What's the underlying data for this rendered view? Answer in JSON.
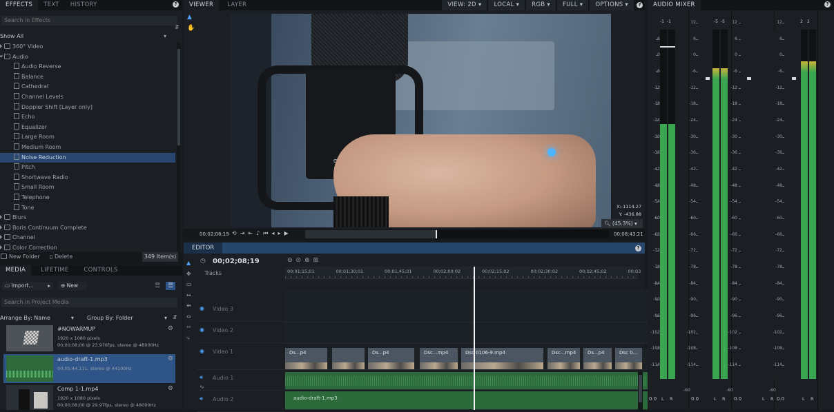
{
  "effects_panel": {
    "tabs": [
      "EFFECTS",
      "TEXT",
      "HISTORY"
    ],
    "search_placeholder": "Search in Effects",
    "filter": "Show All",
    "tree": [
      {
        "label": "360° Video",
        "kind": "folder",
        "level": 0
      },
      {
        "label": "Audio",
        "kind": "folder-open",
        "level": 0
      },
      {
        "label": "Audio Reverse",
        "kind": "effect",
        "level": 1
      },
      {
        "label": "Balance",
        "kind": "effect",
        "level": 1
      },
      {
        "label": "Cathedral",
        "kind": "effect",
        "level": 1
      },
      {
        "label": "Channel Levels",
        "kind": "effect",
        "level": 1
      },
      {
        "label": "Doppler Shift [Layer only]",
        "kind": "effect",
        "level": 1
      },
      {
        "label": "Echo",
        "kind": "effect",
        "level": 1
      },
      {
        "label": "Equalizer",
        "kind": "effect",
        "level": 1
      },
      {
        "label": "Large Room",
        "kind": "effect",
        "level": 1
      },
      {
        "label": "Medium Room",
        "kind": "effect",
        "level": 1
      },
      {
        "label": "Noise Reduction",
        "kind": "effect",
        "level": 1,
        "selected": true
      },
      {
        "label": "Pitch",
        "kind": "effect",
        "level": 1
      },
      {
        "label": "Shortwave Radio",
        "kind": "effect",
        "level": 1
      },
      {
        "label": "Small Room",
        "kind": "effect",
        "level": 1
      },
      {
        "label": "Telephone",
        "kind": "effect",
        "level": 1
      },
      {
        "label": "Tone",
        "kind": "effect",
        "level": 1
      },
      {
        "label": "Blurs",
        "kind": "folder",
        "level": 0
      },
      {
        "label": "Boris Continuum Complete",
        "kind": "folder",
        "level": 0
      },
      {
        "label": "Channel",
        "kind": "folder",
        "level": 0
      },
      {
        "label": "Color Correction",
        "kind": "folder",
        "level": 0
      }
    ],
    "new_folder": "New Folder",
    "delete": "Delete",
    "item_count": "349 Item(s)"
  },
  "media_panel": {
    "tabs": [
      "MEDIA",
      "LIFETIME",
      "CONTROLS"
    ],
    "import": "Import...",
    "new": "New",
    "search_placeholder": "Search in Project Media",
    "arrange": "Arrange By: Name",
    "group": "Group By: Folder",
    "items": [
      {
        "title": "#NOWARMUP",
        "line1": "1920 x 1080 pixels",
        "line2": "00;00;08;00 @ 23.976fps, stereo @ 48000Hz"
      },
      {
        "title": "audio-draft-1.mp3",
        "line1": "00;05;44.111, stereo @ 44100Hz",
        "line2": ""
      },
      {
        "title": "Comp 1-1.mp4",
        "line1": "1920 x 1080 pixels",
        "line2": "00;00;08;00 @ 29.97fps, stereo @ 48000Hz"
      }
    ]
  },
  "viewer": {
    "tabs": [
      "VIEWER",
      "LAYER"
    ],
    "options": [
      "VIEW: 2D",
      "LOCAL",
      "RGB",
      "FULL",
      "OPTIONS"
    ],
    "coord_x_label": "X:",
    "coord_x": "-1114.27",
    "coord_y_label": "Y:",
    "coord_y": "-436.88",
    "zoom": "(45.3%)",
    "time_start": "00;02;08;19",
    "time_end": "00;08;43;21",
    "playhead_fraction": 0.43
  },
  "editor": {
    "tab": "EDITOR",
    "timecode": "00;02;08;19",
    "tracks_label": "Tracks",
    "ruler": [
      "00;01;15;01",
      "00;01;30;01",
      "00;01;45;01",
      "00;02;00;02",
      "00;02;15;02",
      "00;02;30;02",
      "00;02;45;02",
      "00;03"
    ],
    "tracks": [
      "Video 3",
      "Video 2",
      "Video 1",
      "Audio 1",
      "Audio 2"
    ],
    "video_clips": [
      "Ds...p4",
      "Ds...p4",
      "Dsc...mp4",
      "Dsc 0106-9.mp4",
      "Dsc...mp4",
      "Ds...p4",
      "Dsc 0..."
    ],
    "audio_clip": "audio-draft-1.mp3"
  },
  "audio_mixer": {
    "tab": "AUDIO MIXER",
    "scale": [
      "12",
      "6",
      "0",
      "-6",
      "-12",
      "-18",
      "-24",
      "-30",
      "-36",
      "-42",
      "-48",
      "-54",
      "-60",
      "-66",
      "-72",
      "-78",
      "-84",
      "-90",
      "-96",
      "-102",
      "-108",
      "-114"
    ],
    "channels": [
      {
        "peak_l": "-1",
        "peak_r": "-1",
        "level": 0.73,
        "value": "0.0",
        "bottom_label": "-60"
      },
      {
        "peak_l": "-5",
        "peak_r": "-5",
        "level": 0.89,
        "value": "0.0",
        "bottom_label": "-60"
      },
      {
        "peak_l": "",
        "peak_r": "",
        "level": 0,
        "value": "0.0",
        "bottom_label": "-60"
      },
      {
        "peak_l": "2",
        "peak_r": "2",
        "level": 0.91,
        "value": "0.0",
        "bottom_label": ""
      }
    ],
    "lr": [
      "L",
      "R"
    ],
    "colors": {
      "meter_green": "#3aa650",
      "meter_yellow": "#c9b43a"
    }
  }
}
